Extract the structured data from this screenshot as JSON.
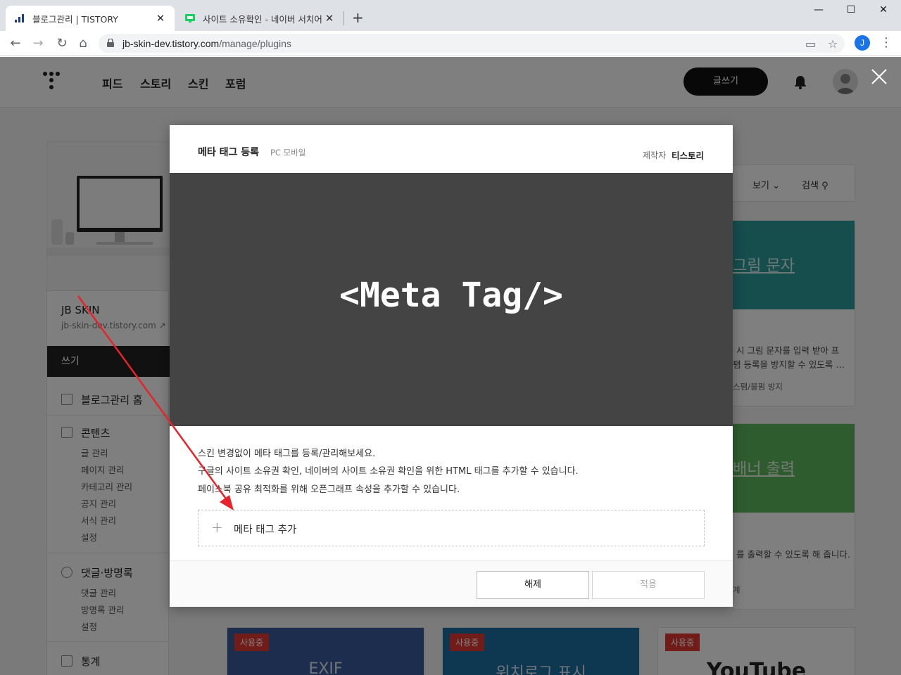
{
  "browser": {
    "tabs": [
      {
        "title": "블로그관리 | TISTORY",
        "active": true
      },
      {
        "title": "사이트 소유확인 - 네이버 서치어",
        "active": false
      }
    ],
    "url_host": "jb-skin-dev.tistory.com",
    "url_path": "/manage/plugins",
    "profile_initial": "J"
  },
  "gnb": {
    "links": [
      "피드",
      "스토리",
      "스킨",
      "포럼"
    ],
    "write_label": "글쓰기"
  },
  "sidebar": {
    "blog_name": "JB SKIN",
    "blog_url": "jb-skin-dev.tistory.com",
    "write_label": "쓰기",
    "home_label": "블로그관리 홈",
    "contents": {
      "title": "콘텐츠",
      "items": [
        "글 관리",
        "페이지 관리",
        "카테고리 관리",
        "공지 관리",
        "서식 관리",
        "설정"
      ]
    },
    "comments": {
      "title": "댓글·방명록",
      "items": [
        "댓글 관리",
        "방명록 관리",
        "설정"
      ]
    },
    "stats": {
      "title": "통계"
    }
  },
  "content_bar": {
    "view_label": "보기",
    "search_label": "검색"
  },
  "cards": {
    "captcha": {
      "title": "그림 문자",
      "desc_1": "시 그림 문자를 입력 받아 프",
      "desc_2": "팸 등록을 방지할 수 있도록 …",
      "tag": "스팸/블펌 방지"
    },
    "banner": {
      "title": "배너 출력",
      "desc": "를 출력할 수 있도록 해 줍니다.",
      "tag": "계"
    },
    "exif": {
      "badge": "사용중",
      "title": "EXIF"
    },
    "location": {
      "badge": "사용중",
      "title": "위치로그 표시"
    },
    "youtube": {
      "badge": "사용중",
      "logo": "YouTube"
    }
  },
  "modal": {
    "title": "메타 태그 등록",
    "subtitle": "PC 모바일",
    "maker_label": "제작자",
    "maker_value": "티스토리",
    "hero_text": "<Meta Tag/>",
    "desc_1": "스킨 변경없이 메타 태그를 등록/관리해보세요.",
    "desc_2": "구글의 사이트 소유권 확인, 네이버의 사이트 소유권 확인을 위한 HTML 태그를 추가할 수 있습니다.",
    "desc_3": "페이스북 공유 최적화를 위해 오픈그래프 속성을 추가할 수 있습니다.",
    "add_label": "메타 태그 추가",
    "release_label": "해제",
    "apply_label": "적용"
  },
  "colors": {
    "captcha_card": "#2a9d9a",
    "banner_card": "#5cb85c",
    "hero_bg": "#444444",
    "badge": "#e53935",
    "arrow": "#e8232b"
  }
}
